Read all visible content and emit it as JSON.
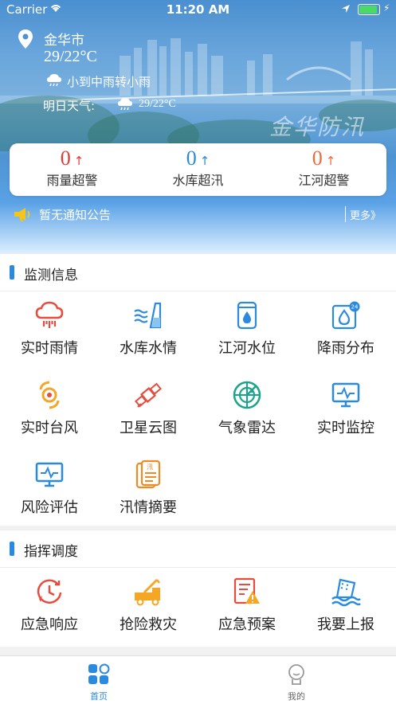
{
  "status": {
    "carrier": "Carrier",
    "time": "11:20 AM"
  },
  "weather": {
    "city": "金华市",
    "temp": "29/22°C",
    "condition": "小到中雨转小雨",
    "tomorrow_label": "明日天气:",
    "tomorrow_temp": "29/22°C",
    "watermark": "金华防汛"
  },
  "alarms": [
    {
      "value": "0",
      "arrow": "↑",
      "label": "雨量超警",
      "color": "#e53935"
    },
    {
      "value": "0",
      "arrow": "↑",
      "label": "水库超汛",
      "color": "#2a8ae0"
    },
    {
      "value": "0",
      "arrow": "↑",
      "label": "江河超警",
      "color": "#f06a3a"
    }
  ],
  "notice": {
    "text": "暂无通知公告",
    "more": "更多》"
  },
  "sections": {
    "monitor": {
      "title": "监测信息",
      "items": [
        {
          "label": "实时雨情",
          "icon": "rain-cloud-icon"
        },
        {
          "label": "水库水情",
          "icon": "reservoir-icon"
        },
        {
          "label": "江河水位",
          "icon": "water-level-icon"
        },
        {
          "label": "降雨分布",
          "icon": "rainfall-distribution-icon"
        },
        {
          "label": "实时台风",
          "icon": "typhoon-icon"
        },
        {
          "label": "卫星云图",
          "icon": "satellite-icon"
        },
        {
          "label": "气象雷达",
          "icon": "radar-icon"
        },
        {
          "label": "实时监控",
          "icon": "monitor-icon"
        },
        {
          "label": "风险评估",
          "icon": "risk-assessment-icon"
        },
        {
          "label": "汛情摘要",
          "icon": "flood-summary-icon"
        }
      ]
    },
    "command": {
      "title": "指挥调度",
      "items": [
        {
          "label": "应急响应",
          "icon": "emergency-response-icon"
        },
        {
          "label": "抢险救灾",
          "icon": "rescue-truck-icon"
        },
        {
          "label": "应急预案",
          "icon": "emergency-plan-icon"
        },
        {
          "label": "我要上报",
          "icon": "report-flood-icon"
        }
      ]
    }
  },
  "tabs": [
    {
      "label": "首页",
      "active": true
    },
    {
      "label": "我的",
      "active": false
    }
  ],
  "colors": {
    "accent": "#2a8ae0",
    "red": "#e94b3c",
    "orange": "#f5a623",
    "blue": "#2a8ae0",
    "teal": "#1aa58a"
  }
}
